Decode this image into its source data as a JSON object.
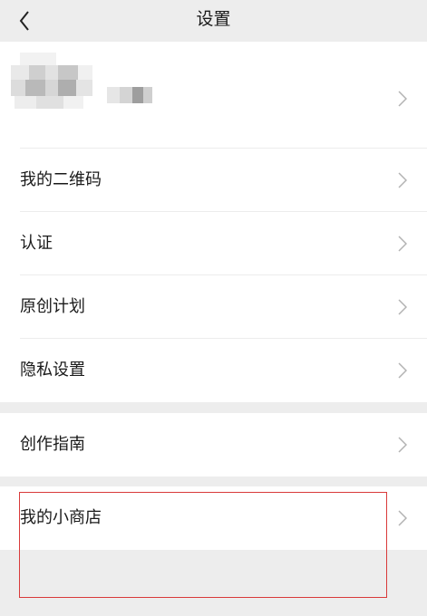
{
  "nav": {
    "title": "设置",
    "back_icon": "chevron-left-icon"
  },
  "profile": {
    "avatar_icon": "blurred-avatar",
    "nickname_icon": "blurred-nickname",
    "chevron_icon": "chevron-right-icon"
  },
  "menu": {
    "qr_code": "我的二维码",
    "verification": "认证",
    "original_plan": "原创计划",
    "privacy_settings": "隐私设置",
    "creation_guide": "创作指南",
    "my_shop": "我的小商店"
  },
  "colors": {
    "background": "#ededed",
    "card": "#ffffff",
    "highlight_border": "#d93a3a"
  }
}
